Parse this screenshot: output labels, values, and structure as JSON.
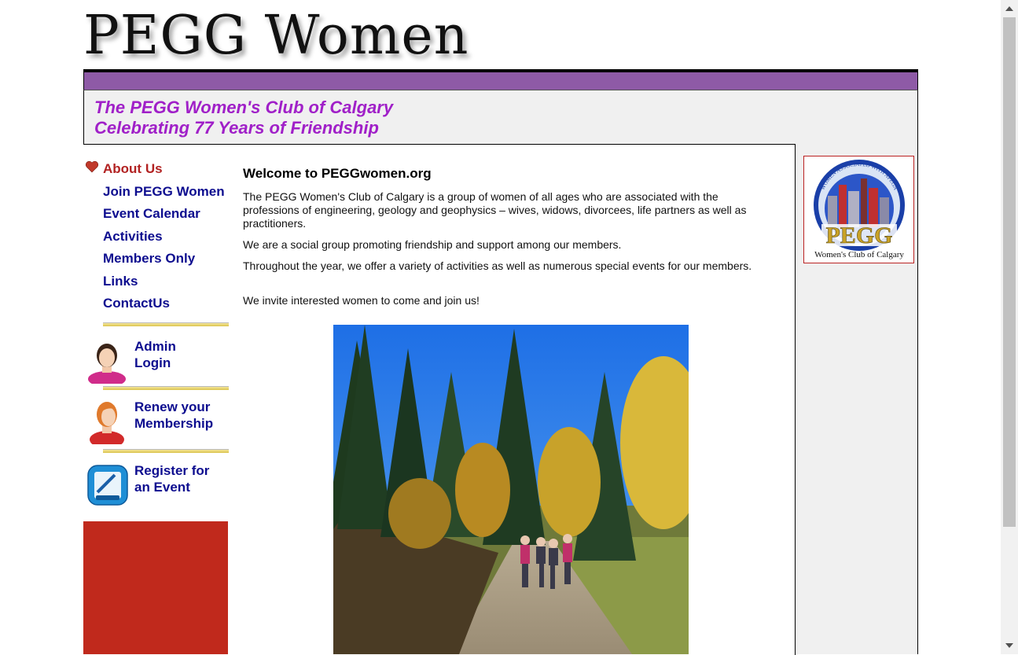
{
  "site": {
    "logo_text": "PEGG Women",
    "tagline_line1": "The PEGG Women's Club of Calgary",
    "tagline_line2": "Celebrating 77 Years of Friendship"
  },
  "nav": {
    "items": [
      {
        "label": "About Us",
        "active": true
      },
      {
        "label": "Join PEGG Women"
      },
      {
        "label": "Event Calendar"
      },
      {
        "label": "Activities"
      },
      {
        "label": "Members Only"
      },
      {
        "label": "Links"
      },
      {
        "label": "ContactUs"
      }
    ]
  },
  "actions": {
    "admin": {
      "line1": "Admin",
      "line2": "Login",
      "icon": "woman-avatar-icon"
    },
    "renew": {
      "line1": "Renew your",
      "line2": "Membership",
      "icon": "woman-red-avatar-icon"
    },
    "register": {
      "line1": "Register for",
      "line2": "an Event",
      "icon": "registration-clipboard-icon"
    }
  },
  "main": {
    "heading": "Welcome to PEGGwomen.org",
    "p1": "The PEGG Women's Club of Calgary is a group of women of all ages who are associated with the professions of engineering, geology and geophysics – wives, widows, divorcees, life partners as well as practitioners.",
    "p2": "We are a social group promoting friendship and support among our members.",
    "p3": "Throughout the year, we offer a variety of activities as well as numerous special events for our members.",
    "p4": "We invite interested women to come and join us!"
  },
  "badge": {
    "arc_text": "WOMEN ASSOCIATED WITH APEGA",
    "title": "PEGG",
    "subtitle": "Women's Club of Calgary"
  },
  "colors": {
    "purple_bar": "#8e5aa6",
    "tagline": "#a020c8",
    "nav_link": "#0d0d8f",
    "nav_active": "#b22222",
    "red_box": "#c0291c"
  }
}
